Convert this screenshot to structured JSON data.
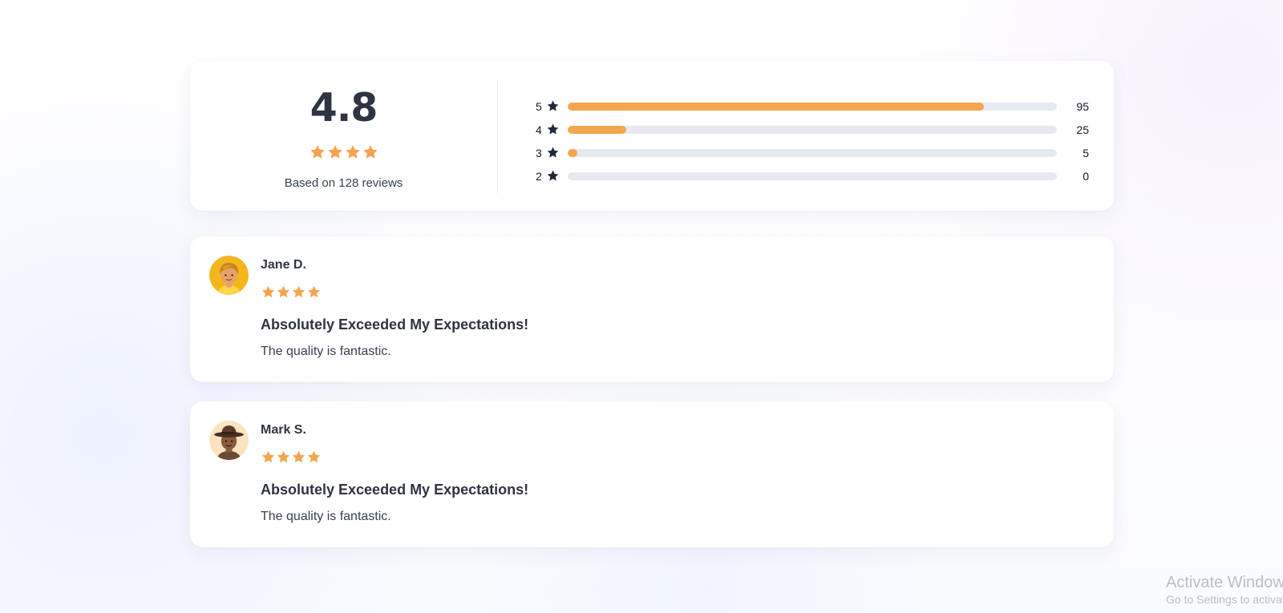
{
  "colors": {
    "accent": "#f2a64f",
    "track": "#e6eaf0",
    "text_dark": "#2f3442",
    "text_body": "#374151",
    "star_dark": "#1f2937"
  },
  "summary": {
    "average": "4.8",
    "average_value": 4.8,
    "star_count_shown": 4,
    "based_on": "Based on 128 reviews",
    "breakdown": [
      {
        "stars": "5",
        "count": "95",
        "fill": 0.85
      },
      {
        "stars": "4",
        "count": "25",
        "fill": 0.12
      },
      {
        "stars": "3",
        "count": "5",
        "fill": 0.02
      },
      {
        "stars": "2",
        "count": "0",
        "fill": 0.0
      }
    ]
  },
  "reviews": [
    {
      "name": "Jane D.",
      "rating": 4,
      "title": "Absolutely Exceeded My Expectations!",
      "text": "The quality is fantastic.",
      "avatar_icon": "blond-person-avatar"
    },
    {
      "name": "Mark S.",
      "rating": 4,
      "title": "Absolutely Exceeded My Expectations!",
      "text": "The quality is fantastic.",
      "avatar_icon": "cowboy-hat-avatar"
    }
  ],
  "system_watermark": {
    "title": "Activate Windows",
    "subtitle": "Go to Settings to activate Windows."
  }
}
